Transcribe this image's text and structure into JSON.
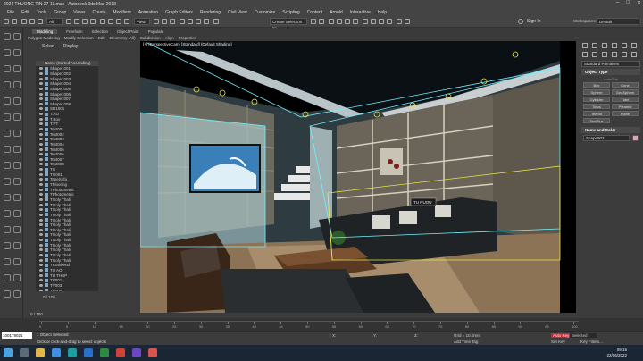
{
  "app": {
    "title": "2021 THUONG TIN 27-11.max - Autodesk 3ds Max 2018",
    "controls": [
      "–",
      "□",
      "✕"
    ]
  },
  "menu": [
    "File",
    "Edit",
    "Tools",
    "Group",
    "Views",
    "Create",
    "Modifiers",
    "Animation",
    "Graph Editors",
    "Rendering",
    "Civil View",
    "Customize",
    "Scripting",
    "Content",
    "Arnold",
    "Interactive",
    "Help"
  ],
  "toolbar": {
    "filter": "All",
    "view": "View",
    "selection_set": "Create Selection Se",
    "sign_in": "Sign In",
    "workspaces_label": "Workspaces:",
    "workspace": "Default"
  },
  "ribbon": {
    "tabs": [
      "Modeling",
      "Freeform",
      "Selection",
      "Object Paint",
      "Populate"
    ],
    "sub": [
      "Polygon Modeling",
      "Modify Selection",
      "Edit",
      "Geometry (All)",
      "Subdivision",
      "Align",
      "Properties"
    ]
  },
  "scene_explorer": {
    "tabs": [
      "Select",
      "Display"
    ],
    "header": "Name (Sorted Ascending)",
    "items": [
      {
        "name": "Shape1001",
        "selected": false
      },
      {
        "name": "Shape1002",
        "selected": false
      },
      {
        "name": "Shape1003",
        "selected": false
      },
      {
        "name": "Shape1004",
        "selected": false
      },
      {
        "name": "Shape1005",
        "selected": false
      },
      {
        "name": "Shape1006",
        "selected": false
      },
      {
        "name": "Shape1007",
        "selected": false
      },
      {
        "name": "Shape1008",
        "selected": false
      },
      {
        "name": "SD1001",
        "selected": false
      },
      {
        "name": "T.AO",
        "selected": false
      },
      {
        "name": "T.Box",
        "selected": false
      },
      {
        "name": "T.PT",
        "selected": false
      },
      {
        "name": "Text001",
        "selected": false
      },
      {
        "name": "Text002",
        "selected": false
      },
      {
        "name": "Text003",
        "selected": false
      },
      {
        "name": "Text004",
        "selected": false
      },
      {
        "name": "Text005",
        "selected": false
      },
      {
        "name": "Text006",
        "selected": false
      },
      {
        "name": "Text007",
        "selected": false
      },
      {
        "name": "Text008",
        "selected": false
      },
      {
        "name": "TG",
        "selected": false
      },
      {
        "name": "TG001",
        "selected": false
      },
      {
        "name": "TapeSofa",
        "selected": false
      },
      {
        "name": "TFlooring",
        "selected": false
      },
      {
        "name": "TPhotometric",
        "selected": false
      },
      {
        "name": "TPhotometric",
        "selected": false
      },
      {
        "name": "TGoly Thali",
        "selected": false
      },
      {
        "name": "TGoly Thali",
        "selected": false
      },
      {
        "name": "TGoly Thali",
        "selected": false
      },
      {
        "name": "TGoly Thali",
        "selected": false
      },
      {
        "name": "TGoly Thali",
        "selected": false
      },
      {
        "name": "TGoly Thali",
        "selected": false
      },
      {
        "name": "TGoly Thali",
        "selected": false
      },
      {
        "name": "TGoly Thali",
        "selected": false
      },
      {
        "name": "TGoly Thali",
        "selected": false
      },
      {
        "name": "TGoly Thali",
        "selected": false
      },
      {
        "name": "TGoly Thali",
        "selected": false
      },
      {
        "name": "TGoly Thali",
        "selected": false
      },
      {
        "name": "TGoly Thali",
        "selected": false
      },
      {
        "name": "TKrankend",
        "selected": false
      },
      {
        "name": "TU AO",
        "selected": false
      },
      {
        "name": "TU THSP",
        "selected": false
      },
      {
        "name": "TV001",
        "selected": false
      },
      {
        "name": "TV003",
        "selected": false
      },
      {
        "name": "TV004",
        "selected": false
      }
    ],
    "footer": "0 / 100"
  },
  "viewport": {
    "label": "[+] [PerspectiveCam] [Standard] [Default Shading]",
    "tag": "TU RUOU"
  },
  "command_panel": {
    "category": "Standard Primitives",
    "rollout_object_type": "Object Type",
    "autogrid": "AutoGrid",
    "buttons": [
      "Box",
      "Cone",
      "Sphere",
      "GeoSphere",
      "Cylinder",
      "Tube",
      "Torus",
      "Pyramid",
      "Teapot",
      "Plane",
      "TextPlus"
    ],
    "rollout_name_color": "Name and Color",
    "object_name": "Shape903"
  },
  "timeline": {
    "frame": "0 / 100",
    "ticks": [
      "0",
      "5",
      "10",
      "15",
      "20",
      "25",
      "30",
      "35",
      "40",
      "45",
      "50",
      "55",
      "60",
      "65",
      "70",
      "75",
      "80",
      "85",
      "90",
      "95",
      "100"
    ]
  },
  "status": {
    "maxscript": "100179021",
    "selected": "1 Object Selected",
    "hint": "Click or click-and-drag to select objects",
    "x_label": "X:",
    "y_label": "Y:",
    "z_label": "Z:",
    "grid": "Grid = 10.0mm",
    "add_time_tag": "Add Time Tag",
    "auto_key": "Auto Key",
    "selected_drop": "Selected",
    "set_key": "Set Key",
    "key_filters": "Key Filters..."
  },
  "taskbar": {
    "time": "09:15",
    "date": "22/06/2022"
  },
  "colors": {
    "ui_bg": "#3c3c3c",
    "selection": "#2f5b86",
    "bbox_cyan": "#6ff0ff",
    "bbox_yellow": "#e8e34a"
  }
}
